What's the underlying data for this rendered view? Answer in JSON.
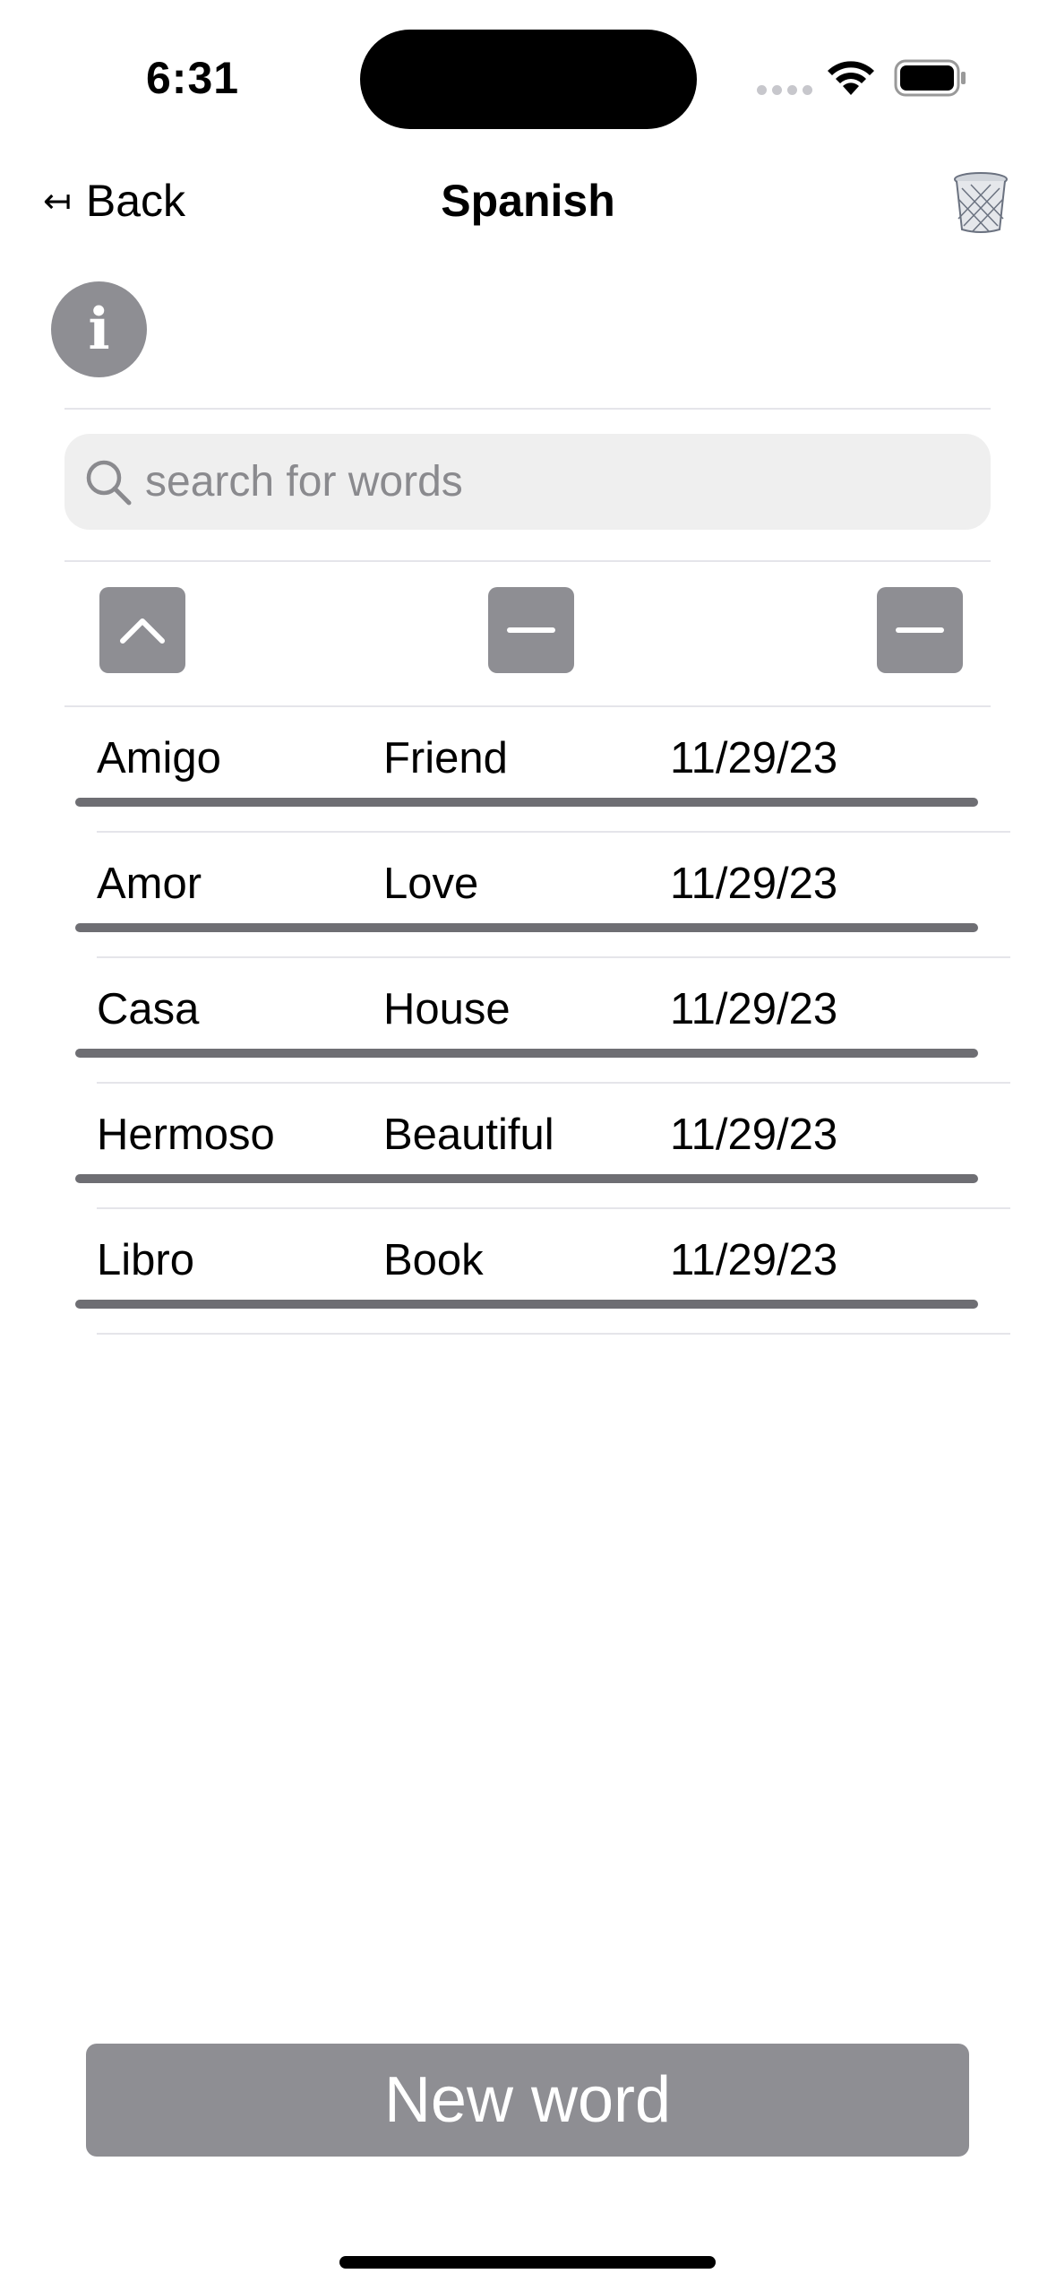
{
  "status_bar": {
    "time": "6:31",
    "wifi_icon": "wifi-icon",
    "battery_icon": "battery-icon",
    "signal_icon": "cellular-dots-icon"
  },
  "nav": {
    "back_arrow": "↤",
    "back_label": "Back",
    "title": "Spanish",
    "trash_icon": "trash-icon"
  },
  "info": {
    "glyph": "i",
    "icon": "info-icon"
  },
  "search": {
    "placeholder": "search for words",
    "value": "",
    "icon": "search-icon"
  },
  "sort_buttons": [
    {
      "icon": "chevron-up-icon",
      "state": "ascending"
    },
    {
      "icon": "minus-icon",
      "state": "none"
    },
    {
      "icon": "minus-icon",
      "state": "none"
    }
  ],
  "words": [
    {
      "word": "Amigo",
      "translation": "Friend",
      "date": "11/29/23"
    },
    {
      "word": "Amor",
      "translation": "Love",
      "date": "11/29/23"
    },
    {
      "word": "Casa",
      "translation": "House",
      "date": "11/29/23"
    },
    {
      "word": "Hermoso",
      "translation": "Beautiful",
      "date": "11/29/23"
    },
    {
      "word": "Libro",
      "translation": "Book",
      "date": "11/29/23"
    }
  ],
  "new_word_button": "New word",
  "colors": {
    "button_gray": "#8e8e93",
    "bar_gray": "#6e6e73",
    "search_bg": "#efefef",
    "placeholder": "#8a8a8e"
  }
}
